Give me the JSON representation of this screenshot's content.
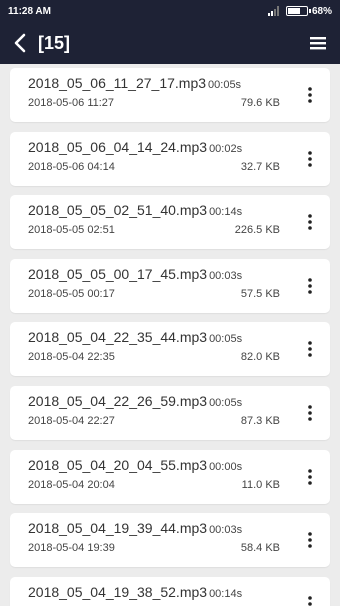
{
  "status": {
    "time": "11:28 AM",
    "battery": "68%",
    "battery_level": 0.68
  },
  "header": {
    "title": "[15]"
  },
  "recordings": [
    {
      "name": "2018_05_06_11_27_17.mp3",
      "duration": "00:05s",
      "date": "2018-05-06  11:27",
      "size": "79.6 KB"
    },
    {
      "name": "2018_05_06_04_14_24.mp3",
      "duration": "00:02s",
      "date": "2018-05-06  04:14",
      "size": "32.7 KB"
    },
    {
      "name": "2018_05_05_02_51_40.mp3",
      "duration": "00:14s",
      "date": "2018-05-05  02:51",
      "size": "226.5 KB"
    },
    {
      "name": "2018_05_05_00_17_45.mp3",
      "duration": "00:03s",
      "date": "2018-05-05  00:17",
      "size": "57.5 KB"
    },
    {
      "name": "2018_05_04_22_35_44.mp3",
      "duration": "00:05s",
      "date": "2018-05-04  22:35",
      "size": "82.0 KB"
    },
    {
      "name": "2018_05_04_22_26_59.mp3",
      "duration": "00:05s",
      "date": "2018-05-04  22:27",
      "size": "87.3 KB"
    },
    {
      "name": "2018_05_04_20_04_55.mp3",
      "duration": "00:00s",
      "date": "2018-05-04  20:04",
      "size": "11.0 KB"
    },
    {
      "name": "2018_05_04_19_39_44.mp3",
      "duration": "00:03s",
      "date": "2018-05-04  19:39",
      "size": "58.4 KB"
    },
    {
      "name": "2018_05_04_19_38_52.mp3",
      "duration": "00:14s",
      "date": "",
      "size": ""
    }
  ],
  "colors": {
    "bar": "#1e2235",
    "background": "#ececec",
    "card": "#ffffff"
  },
  "icons": {
    "back": "chevron-left-icon",
    "menu": "hamburger-menu-icon",
    "more": "more-vertical-icon"
  }
}
